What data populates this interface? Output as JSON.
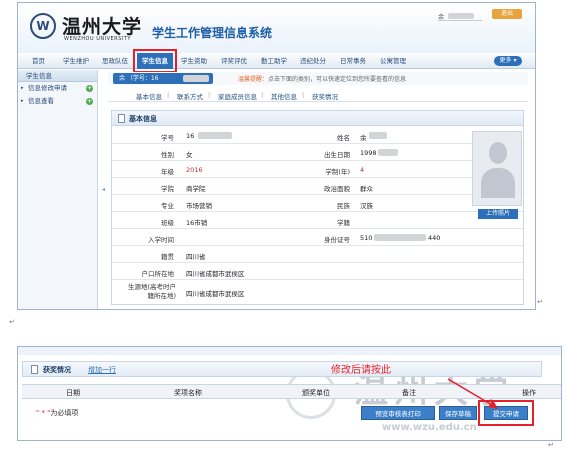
{
  "header": {
    "university_cn": "温州大学",
    "university_en": "WENZHOU UNIVERSITY",
    "system_title": "学生工作管理信息系统",
    "user_name": "余",
    "logout_label": "退出"
  },
  "nav": {
    "items": [
      "首页",
      "学生维护",
      "思政队伍",
      "学生信息",
      "学生资助",
      "评奖评优",
      "勤工助学",
      "违纪处分",
      "日常事务",
      "公寓管理"
    ],
    "active_index": 3,
    "more_label": "更多"
  },
  "sidebar": {
    "title": "学生信息",
    "items": [
      "信息修改申请",
      "信息查看"
    ]
  },
  "main": {
    "id_pill": "余   （学号：16",
    "tip_label": "温馨提醒：",
    "tip_text": "点击下面的类别，可以快速定位到您所要查看的信息",
    "subtabs": [
      "基本信息",
      "联系方式",
      "家庭成员信息",
      "其他信息",
      "获奖情况"
    ],
    "card_title": "基本信息",
    "fields": {
      "student_id_label": "学号",
      "student_id_value": "16",
      "name_label": "姓名",
      "name_value": "余",
      "gender_label": "性别",
      "gender_value": "女",
      "birth_label": "出生日期",
      "birth_value": "1998",
      "grade_label": "年级",
      "grade_value": "2016",
      "years_label": "学制(年)",
      "years_value": "4",
      "college_label": "学院",
      "college_value": "商学院",
      "politics_label": "政治面貌",
      "politics_value": "群众",
      "major_label": "专业",
      "major_value": "市场营销",
      "ethnicity_label": "民族",
      "ethnicity_value": "汉族",
      "class_label": "班级",
      "class_value": "16市销",
      "degree_label": "学籍",
      "degree_value": "",
      "enroll_label": "入学时间",
      "enroll_value": "",
      "idcard_label": "身份证号",
      "idcard_value_prefix": "510",
      "idcard_value_suffix": "440",
      "native_label": "籍贯",
      "native_value": "四川省",
      "hukou_label": "户口所在地",
      "hukou_value": "四川省成都市武侯区",
      "origin_label": "生源地(高考时户籍所在地)",
      "origin_value": "四川省成都市武侯区"
    },
    "upload_label": "上传照片"
  },
  "awards": {
    "title": "获奖情况",
    "add_label": "增加一行",
    "columns": [
      "日期",
      "奖项名称",
      "颁奖单位",
      "备注",
      "操作"
    ],
    "required_note_star": "\" * \"",
    "required_note_text": "为必填项",
    "buttons": [
      "预览审核表打印",
      "保存草稿",
      "提交申请"
    ]
  },
  "annotation": {
    "text": "修改后请按此"
  },
  "watermark": {
    "text": "温州大学",
    "url": "www.wzu.edu.cn"
  }
}
